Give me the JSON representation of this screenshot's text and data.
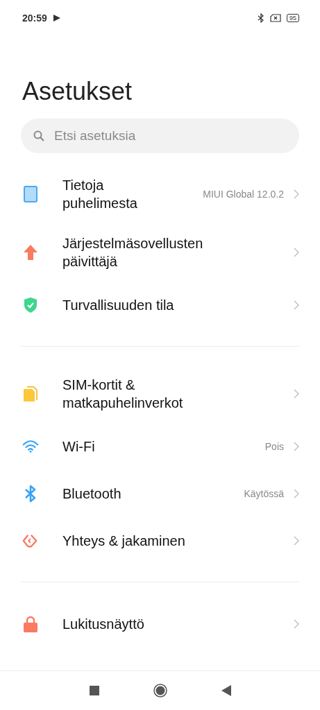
{
  "status_bar": {
    "time": "20:59",
    "battery": "95"
  },
  "title": "Asetukset",
  "search": {
    "placeholder": "Etsi asetuksia"
  },
  "groups": [
    {
      "items": [
        {
          "label": "Tietoja puhelimesta",
          "value": "MIUI Global 12.0.2"
        },
        {
          "label": "Järjestelmäsovellusten päivittäjä"
        },
        {
          "label": "Turvallisuuden tila"
        }
      ]
    },
    {
      "items": [
        {
          "label": "SIM-kortit & matkapuhelinverkot"
        },
        {
          "label": "Wi-Fi",
          "value": "Pois"
        },
        {
          "label": "Bluetooth",
          "value": "Käytössä"
        },
        {
          "label": "Yhteys & jakaminen"
        }
      ]
    },
    {
      "items": [
        {
          "label": "Lukitusnäyttö"
        }
      ]
    }
  ]
}
